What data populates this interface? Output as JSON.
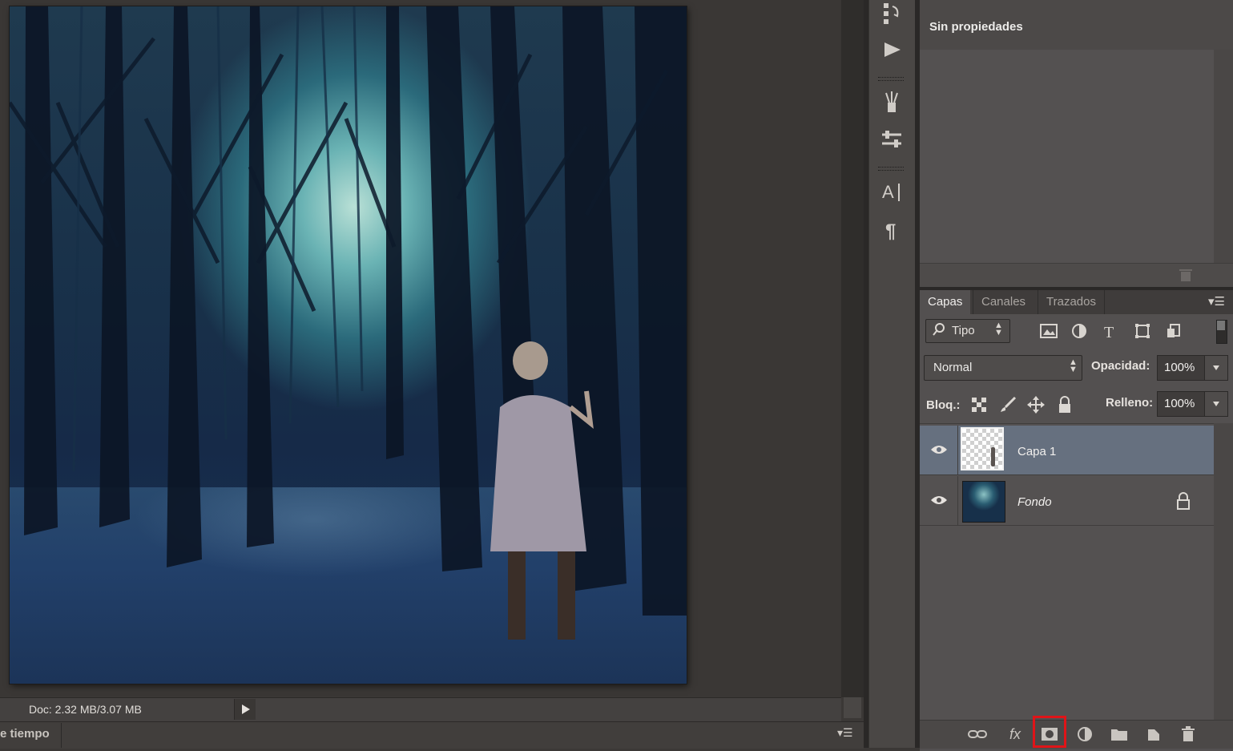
{
  "status": {
    "doc_size": "Doc: 2.32 MB/3.07 MB",
    "timeline_label": "e tiempo",
    "timeline_menu": "▾☰"
  },
  "properties": {
    "title": "Sin propiedades"
  },
  "layers_panel": {
    "tabs": [
      "Capas",
      "Canales",
      "Trazados"
    ],
    "panel_menu": "▾☰",
    "filter_label": "Tipo",
    "blend_mode": "Normal",
    "opacity_label": "Opacidad:",
    "opacity_value": "100%",
    "lock_label": "Bloq.:",
    "fill_label": "Relleno:",
    "fill_value": "100%",
    "layers": [
      {
        "name": "Capa 1",
        "selected": true,
        "locked": false
      },
      {
        "name": "Fondo",
        "selected": false,
        "locked": true
      }
    ],
    "footer_fx": "fx"
  },
  "icons": {
    "highlight_color": "#e01418",
    "selected_layer_color": "#66707f"
  }
}
